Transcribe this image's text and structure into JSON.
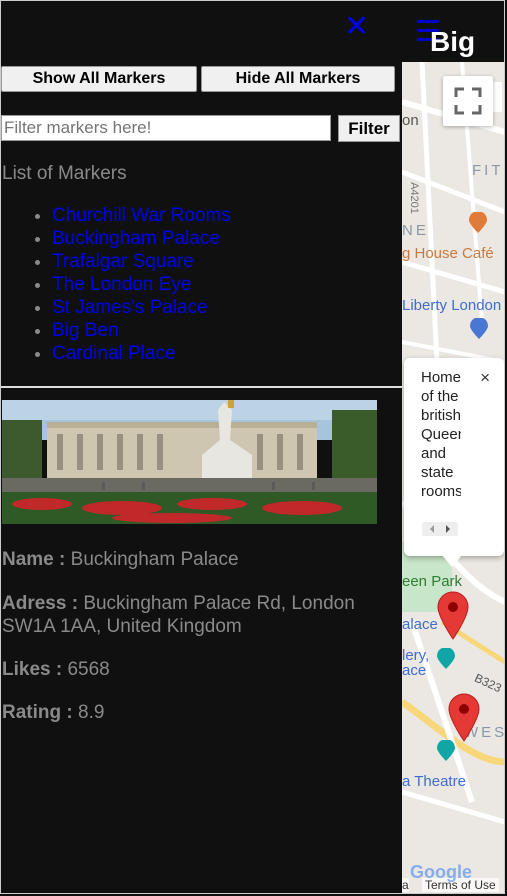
{
  "header": {
    "close_symbol": "✕",
    "brand": "Big",
    "menu_icon": "hamburger-icon"
  },
  "toolbar": {
    "show_all": "Show All Markers",
    "hide_all": "Hide All Markers"
  },
  "filter": {
    "placeholder": "Filter markers here!",
    "button": "Filter"
  },
  "list": {
    "title": "List of Markers",
    "items": [
      "Churchill War Rooms",
      "Buckingham Palace",
      "Trafalgar Square",
      "The London Eye",
      "St James's Palace",
      "Big Ben",
      "Cardinal Place"
    ]
  },
  "details": {
    "name_label": "Name :",
    "name_value": "Buckingham Palace",
    "address_label": "Adress :",
    "address_value": "Buckingham Palace Rd, London SW1A 1AA, United Kingdom",
    "likes_label": "Likes :",
    "likes_value": "6568",
    "rating_label": "Rating :",
    "rating_value": "8.9"
  },
  "map": {
    "labels": {
      "fitz": "FIT",
      "house_cafe": "g House Café",
      "liberty": "Liberty London",
      "green_park": "een Park",
      "palace": "alace",
      "gallery1": "lery,",
      "gallery2": "ace",
      "road": "B323",
      "west": "WES",
      "theatre": "a Theatre",
      "a4201": "A4201",
      "ne": "NE",
      "on": "on"
    },
    "infowindow": {
      "text": "Home of the british Queen and state rooms",
      "close": "×"
    },
    "footer": {
      "terms": "Terms of Use",
      "data": "a",
      "google": "Google"
    }
  },
  "colors": {
    "link": "#0000ee",
    "background": "#101010",
    "pin": "#e53935"
  }
}
